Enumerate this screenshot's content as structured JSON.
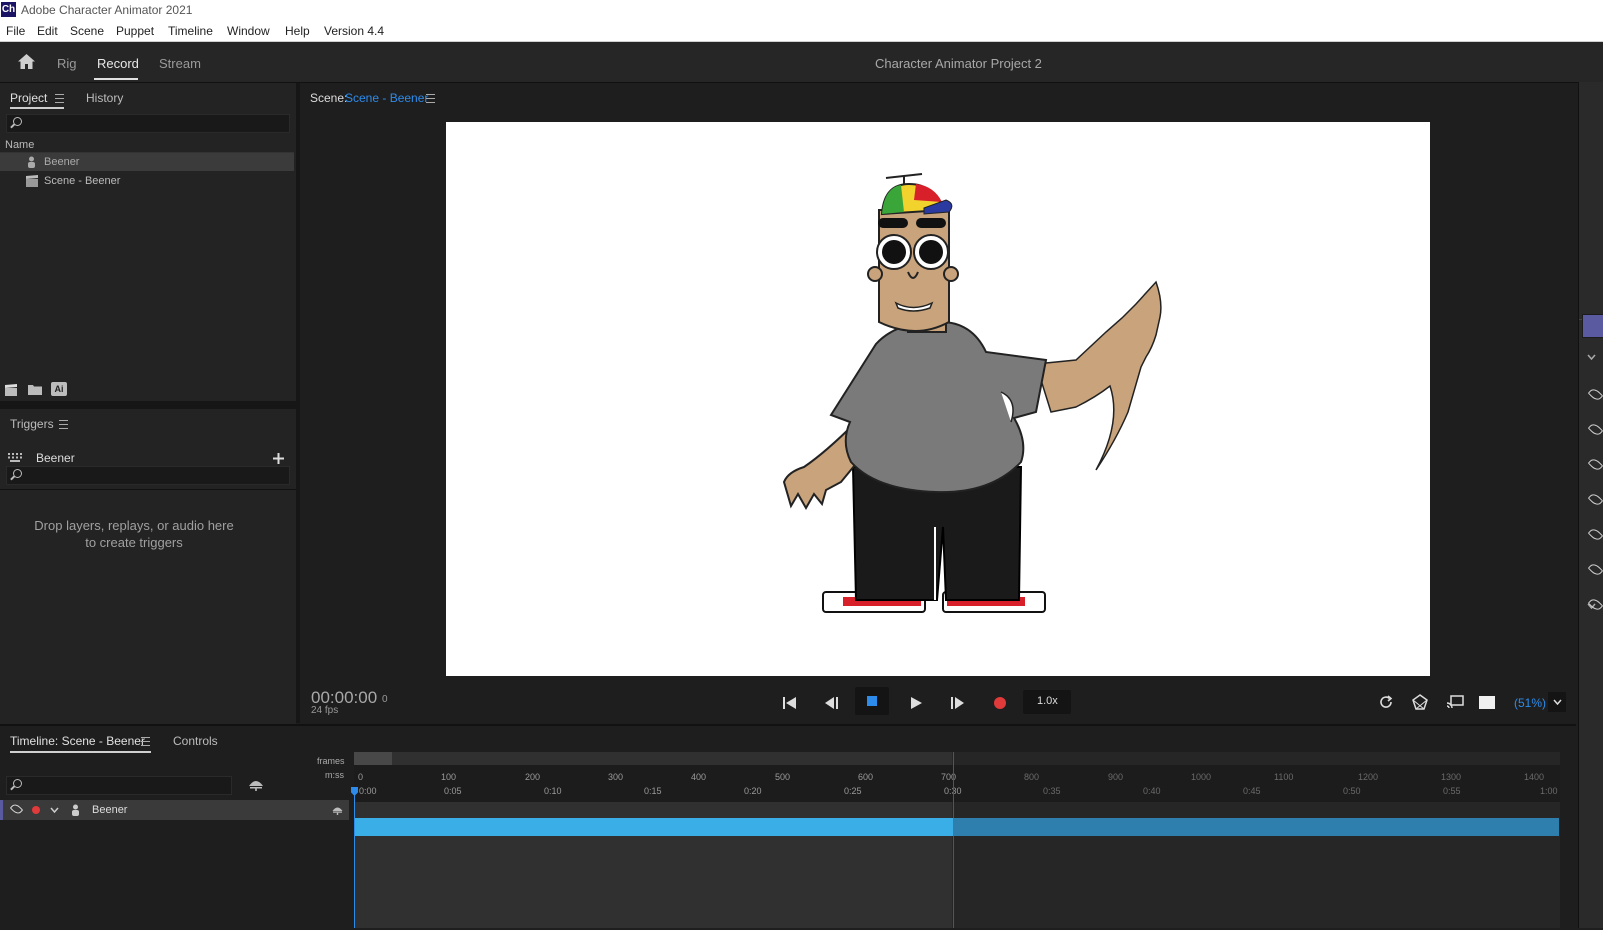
{
  "app": {
    "icon_label": "Ch",
    "title": "Adobe Character Animator 2021"
  },
  "menu": [
    "File",
    "Edit",
    "Scene",
    "Puppet",
    "Timeline",
    "Window",
    "Help",
    "Version 4.4"
  ],
  "workspace": {
    "tabs": [
      "Rig",
      "Record",
      "Stream"
    ],
    "active": "Record",
    "project_name": "Character Animator Project 2"
  },
  "project_panel": {
    "tabs": [
      "Project",
      "History"
    ],
    "column_header": "Name",
    "items": [
      {
        "label": "Beener",
        "icon": "puppet-icon",
        "selected": true
      },
      {
        "label": "Scene - Beener",
        "icon": "scene-icon",
        "selected": false
      }
    ],
    "footer_ai_label": "Ai"
  },
  "triggers_panel": {
    "title": "Triggers",
    "puppet": "Beener",
    "empty_line1": "Drop layers, replays, or audio here",
    "empty_line2": "to create triggers"
  },
  "scene_panel": {
    "label": "Scene:",
    "scene_name": "Scene - Beener"
  },
  "transport": {
    "timecode": "00:00:00",
    "frame": "0",
    "fps": "24 fps",
    "speed": "1.0x",
    "zoom": "(51%)"
  },
  "timeline_panel": {
    "tabs": [
      "Timeline: Scene - Beener",
      "Controls"
    ],
    "frames_label": "frames",
    "mss_label": "m:ss",
    "frame_ticks": [
      "0",
      "100",
      "200",
      "300",
      "400",
      "500",
      "600",
      "700",
      "800",
      "900",
      "1000",
      "1100",
      "1200",
      "1300",
      "1400"
    ],
    "time_ticks": [
      "0:00",
      "0:05",
      "0:10",
      "0:15",
      "0:20",
      "0:25",
      "0:30",
      "0:35",
      "0:40",
      "0:45",
      "0:50",
      "0:55",
      "1:00"
    ],
    "track": {
      "name": "Beener"
    }
  },
  "colors": {
    "accent": "#2d8ceb",
    "track_bar": "#3aaee6",
    "record": "#e03a3a"
  }
}
